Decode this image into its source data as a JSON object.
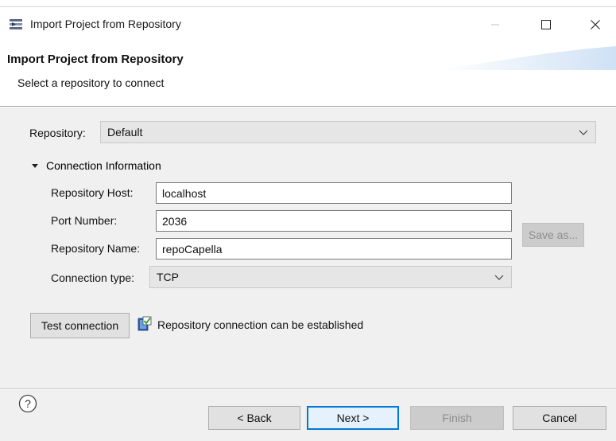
{
  "window": {
    "title": "Import Project from Repository",
    "controls": [
      "minimize",
      "maximize",
      "close"
    ]
  },
  "header": {
    "title": "Import Project from Repository",
    "subtitle": "Select a repository to connect"
  },
  "form": {
    "repository_label": "Repository:",
    "repository_value": "Default",
    "section_label": "Connection Information",
    "host_label": "Repository Host:",
    "host_value": "localhost",
    "port_label": "Port Number:",
    "port_value": "2036",
    "name_label": "Repository Name:",
    "name_value": "repoCapella",
    "type_label": "Connection type:",
    "type_value": "TCP",
    "save_as_label": "Save as..."
  },
  "test": {
    "button_label": "Test connection",
    "status_text": "Repository connection can be established"
  },
  "footer": {
    "back_label": "< Back",
    "next_label": "Next >",
    "finish_label": "Finish",
    "cancel_label": "Cancel"
  },
  "colors": {
    "accent": "#0078d7",
    "content_bg": "#f0f0f0"
  }
}
